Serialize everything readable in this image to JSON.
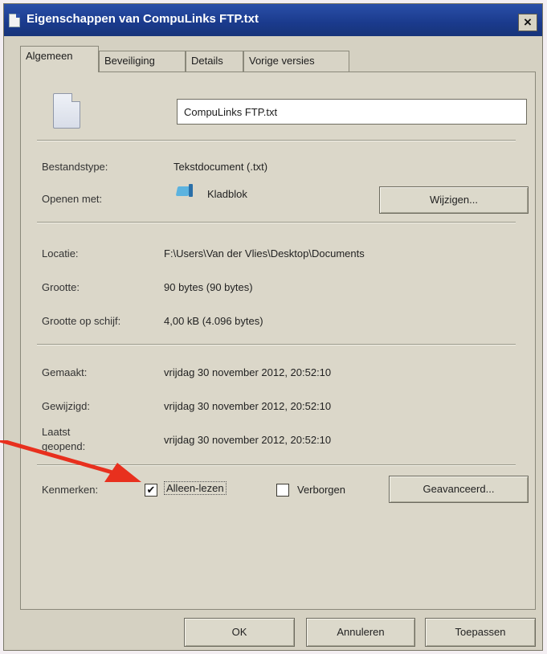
{
  "window": {
    "title": "Eigenschappen van CompuLinks FTP.txt",
    "close_label": "×"
  },
  "tabs": [
    {
      "label": "Algemeen",
      "active": true
    },
    {
      "label": "Beveiliging",
      "active": false
    },
    {
      "label": "Details",
      "active": false
    },
    {
      "label": "Vorige versies",
      "active": false
    }
  ],
  "file": {
    "name": "CompuLinks FTP.txt"
  },
  "props": {
    "type_label": "Bestandstype:",
    "type_value": "Tekstdocument (.txt)",
    "opens_label": "Openen met:",
    "opens_value": "Kladblok",
    "change_button": "Wijzigen...",
    "location_label": "Locatie:",
    "location_value": "F:\\Users\\Van der Vlies\\Desktop\\Documents",
    "size_label": "Grootte:",
    "size_value": "90 bytes (90 bytes)",
    "disk_label": "Grootte op schijf:",
    "disk_value": "4,00 kB (4.096 bytes)",
    "created_label": "Gemaakt:",
    "created_value": "vrijdag 30 november 2012, 20:52:10",
    "modified_label": "Gewijzigd:",
    "modified_value": "vrijdag 30 november 2012, 20:52:10",
    "accessed_label_1": "Laatst",
    "accessed_label_2": "geopend:",
    "accessed_value": "vrijdag 30 november 2012, 20:52:10"
  },
  "attributes": {
    "label": "Kenmerken:",
    "readonly_label": "Alleen-lezen",
    "readonly_checked": true,
    "readonly_mark": "✔",
    "hidden_label": "Verborgen",
    "hidden_checked": false,
    "advanced_button": "Geavanceerd..."
  },
  "footer": {
    "ok": "OK",
    "cancel": "Annuleren",
    "apply": "Toepassen"
  },
  "colors": {
    "titlebar": "#1a3a8c",
    "dialog": "#d5d1c2",
    "arrow": "#e8301e"
  }
}
